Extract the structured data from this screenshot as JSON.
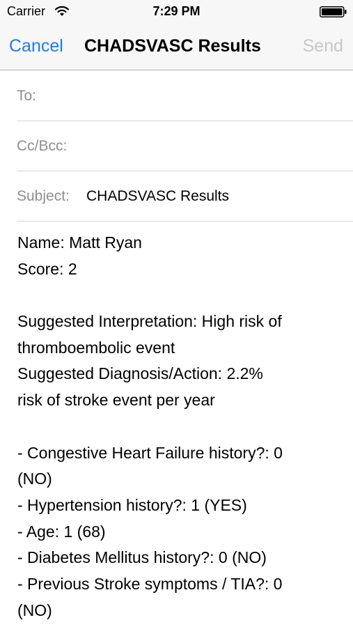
{
  "status": {
    "carrier": "Carrier",
    "time": "7:29 PM"
  },
  "nav": {
    "cancel": "Cancel",
    "title": "CHADSVASC Results",
    "send": "Send"
  },
  "fields": {
    "to_label": "To:",
    "cc_label": "Cc/Bcc:",
    "subject_label": "Subject:",
    "subject_value": "CHADSVASC Results"
  },
  "body": {
    "lines": [
      "Name: Matt Ryan",
      "Score: 2",
      "",
      "Suggested Interpretation: High risk of",
      "thromboembolic event",
      "Suggested Diagnosis/Action: 2.2%",
      "risk of stroke event per year",
      "",
      "- Congestive Heart Failure history?: 0",
      "(NO)",
      "- Hypertension history?: 1 (YES)",
      "- Age: 1 (68)",
      "- Diabetes Mellitus history?: 0 (NO)",
      "- Previous Stroke symptoms / TIA?: 0",
      "(NO)"
    ]
  },
  "colors": {
    "accent": "#1a7cf5",
    "disabled": "#c7c7cc",
    "label_gray": "#8e8e93"
  },
  "icons": {
    "wifi": "wifi-icon",
    "battery": "battery-icon"
  }
}
